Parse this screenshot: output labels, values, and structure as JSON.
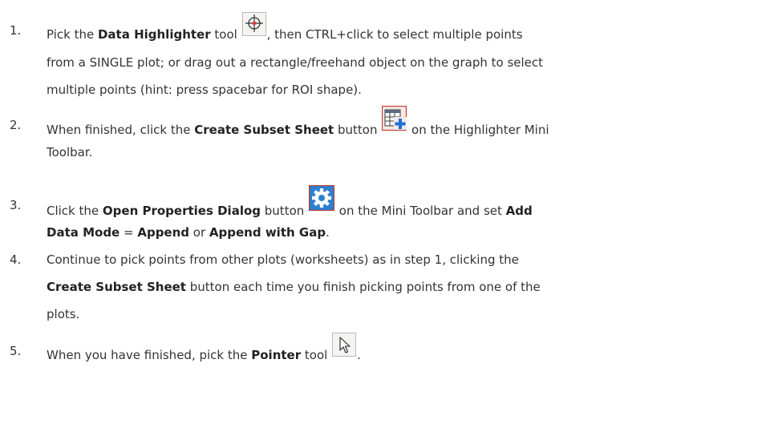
{
  "steps": [
    {
      "number": "1.",
      "lines": [
        [
          {
            "t": "Pick the "
          },
          {
            "b": "Data Highlighter"
          },
          {
            "t": " tool "
          },
          {
            "icon": "data-highlighter-icon"
          },
          {
            "t": ", then CTRL+click to select multiple points"
          }
        ],
        [
          {
            "t": "from a SINGLE plot; or drag out a rectangle/freehand object on the graph to select"
          }
        ],
        [
          {
            "t": "multiple points (hint: press spacebar for ROI shape)."
          }
        ]
      ]
    },
    {
      "number": "2.",
      "lines": [
        [
          {
            "t": "When finished, click the "
          },
          {
            "b": "Create Subset Sheet"
          },
          {
            "t": " button "
          },
          {
            "icon": "create-subset-sheet-icon"
          },
          {
            "t": " on the Highlighter Mini"
          }
        ],
        [
          {
            "t": "Toolbar."
          }
        ]
      ]
    },
    {
      "number": "3.",
      "lines": [
        [
          {
            "t": "Click the "
          },
          {
            "b": "Open Properties Dialog"
          },
          {
            "t": " button "
          },
          {
            "icon": "open-properties-dialog-icon"
          },
          {
            "t": " on the Mini Toolbar and set "
          },
          {
            "b": "Add"
          }
        ],
        [
          {
            "b": "Data Mode"
          },
          {
            "t": " = "
          },
          {
            "b": "Append"
          },
          {
            "t": " or "
          },
          {
            "b": "Append with Gap"
          },
          {
            "t": "."
          }
        ]
      ]
    },
    {
      "number": "4.",
      "lines": [
        [
          {
            "t": "Continue to pick points from other plots (worksheets) as in step 1, clicking the"
          }
        ],
        [
          {
            "b": "Create Subset Sheet"
          },
          {
            "t": " button each time you finish picking points from one of the"
          }
        ],
        [
          {
            "t": "plots."
          }
        ]
      ]
    },
    {
      "number": "5.",
      "lines": [
        [
          {
            "t": "When you have finished, pick the "
          },
          {
            "b": "Pointer"
          },
          {
            "t": " tool "
          },
          {
            "icon": "pointer-icon"
          },
          {
            "t": "."
          }
        ]
      ]
    }
  ]
}
